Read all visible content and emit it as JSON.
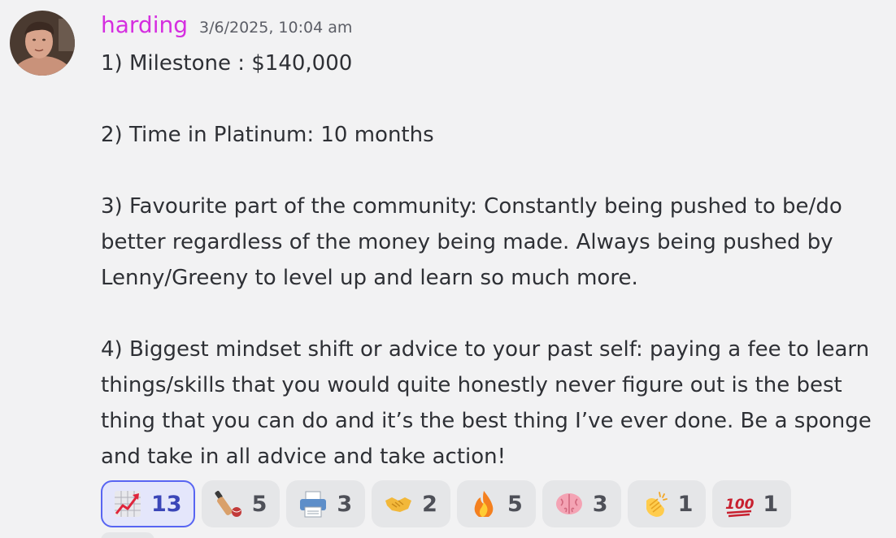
{
  "message": {
    "author": "harding",
    "timestamp": "3/6/2025, 10:04 am",
    "author_color": "#d52ee0",
    "paragraphs": [
      "1) Milestone : $140,000",
      "2) Time in Platinum: 10 months",
      "3) Favourite part of the community: Constantly being pushed to be/do better regardless of the money being made. Always being pushed by Lenny/Greeny to level up and learn so much more.",
      "4) Biggest mindset shift or advice to your past self: paying a fee to learn things/skills that you would quite honestly never figure out is the best thing that you can do and it’s the best thing I’ve ever done. Be a sponge and take in all advice and take action!"
    ]
  },
  "reactions": [
    {
      "icon": "chart-increasing-icon",
      "count": "13",
      "active": true
    },
    {
      "icon": "cricket-bat-icon",
      "count": "5",
      "active": false
    },
    {
      "icon": "printer-icon",
      "count": "3",
      "active": false
    },
    {
      "icon": "handshake-icon",
      "count": "2",
      "active": false
    },
    {
      "icon": "fire-icon",
      "count": "5",
      "active": false
    },
    {
      "icon": "brain-icon",
      "count": "3",
      "active": false
    },
    {
      "icon": "clapping-hands-icon",
      "count": "1",
      "active": false
    },
    {
      "icon": "hundred-points-icon",
      "count": "1",
      "active": false
    }
  ],
  "colors": {
    "background": "#f2f2f3",
    "active_reaction_border": "#5865f2",
    "active_reaction_bg": "#e4e6fb"
  }
}
